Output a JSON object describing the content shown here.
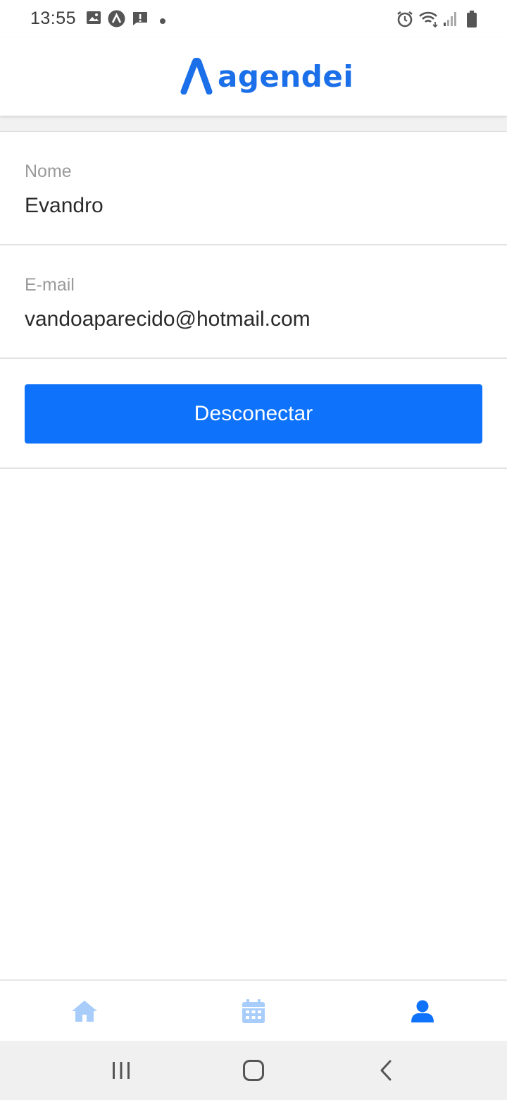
{
  "status_bar": {
    "time": "13:55",
    "left_icons": [
      "image-icon",
      "android-a-icon",
      "alert-message-icon",
      "dot-icon"
    ],
    "right_icons": [
      "alarm-icon",
      "wifi-icon",
      "signal-icon",
      "battery-icon"
    ]
  },
  "header": {
    "logo_text": "agendei",
    "brand_color": "#1b6fe8"
  },
  "profile": {
    "name_label": "Nome",
    "name_value": "Evandro",
    "email_label": "E-mail",
    "email_value": "vandoaparecido@hotmail.com"
  },
  "actions": {
    "logout_label": "Desconectar",
    "button_color": "#0e72fb"
  },
  "tab_bar": {
    "tabs": [
      {
        "icon": "home-icon",
        "active": false
      },
      {
        "icon": "calendar-icon",
        "active": false
      },
      {
        "icon": "user-icon",
        "active": true
      }
    ],
    "active_color": "#0e72fb",
    "inactive_color": "#a9cdfb"
  },
  "system_nav": {
    "buttons": [
      "recents-icon",
      "home-button-icon",
      "back-icon"
    ]
  }
}
